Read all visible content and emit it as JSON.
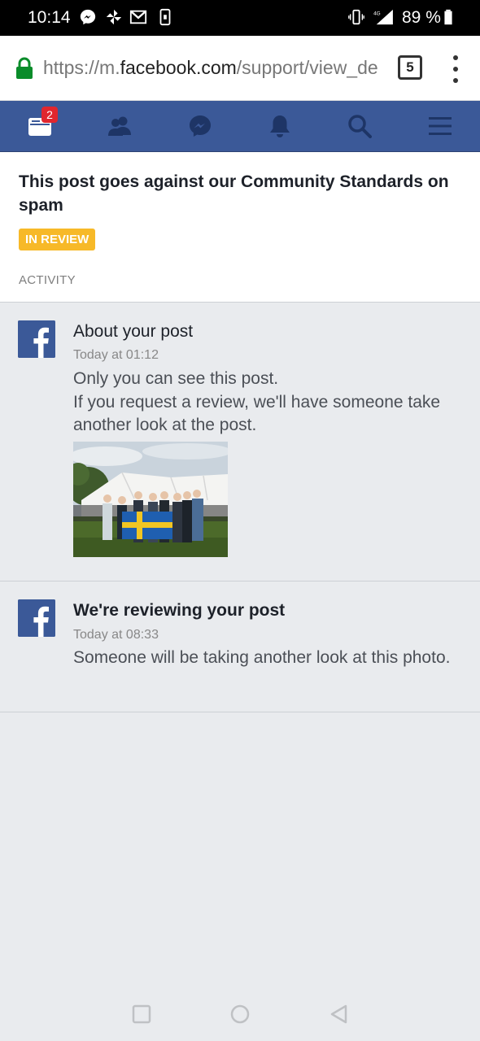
{
  "status_bar": {
    "time": "10:14",
    "network": "4G",
    "battery": "89 %"
  },
  "browser": {
    "url_prefix": "https://m.",
    "url_host": "facebook.com",
    "url_path": "/support/view_de",
    "tab_count": "5"
  },
  "fb_nav": {
    "notification_badge": "2"
  },
  "header": {
    "title": "This post goes against our Community Standards on spam",
    "status_badge": "IN REVIEW",
    "activity_label": "ACTIVITY"
  },
  "activities": [
    {
      "title": "About your post",
      "time": "Today at 01:12",
      "body_line1": "Only you can see this post.",
      "body_line2": "If you request a review, we'll have someone take another look at the post."
    },
    {
      "title": "We're reviewing your post",
      "time": "Today at 08:33",
      "body": "Someone will be taking another look at this photo."
    }
  ],
  "colors": {
    "fb_blue": "#3b5998",
    "badge_yellow": "#f7b928",
    "notification_red": "#e0262e",
    "background": "#e9ebee"
  }
}
